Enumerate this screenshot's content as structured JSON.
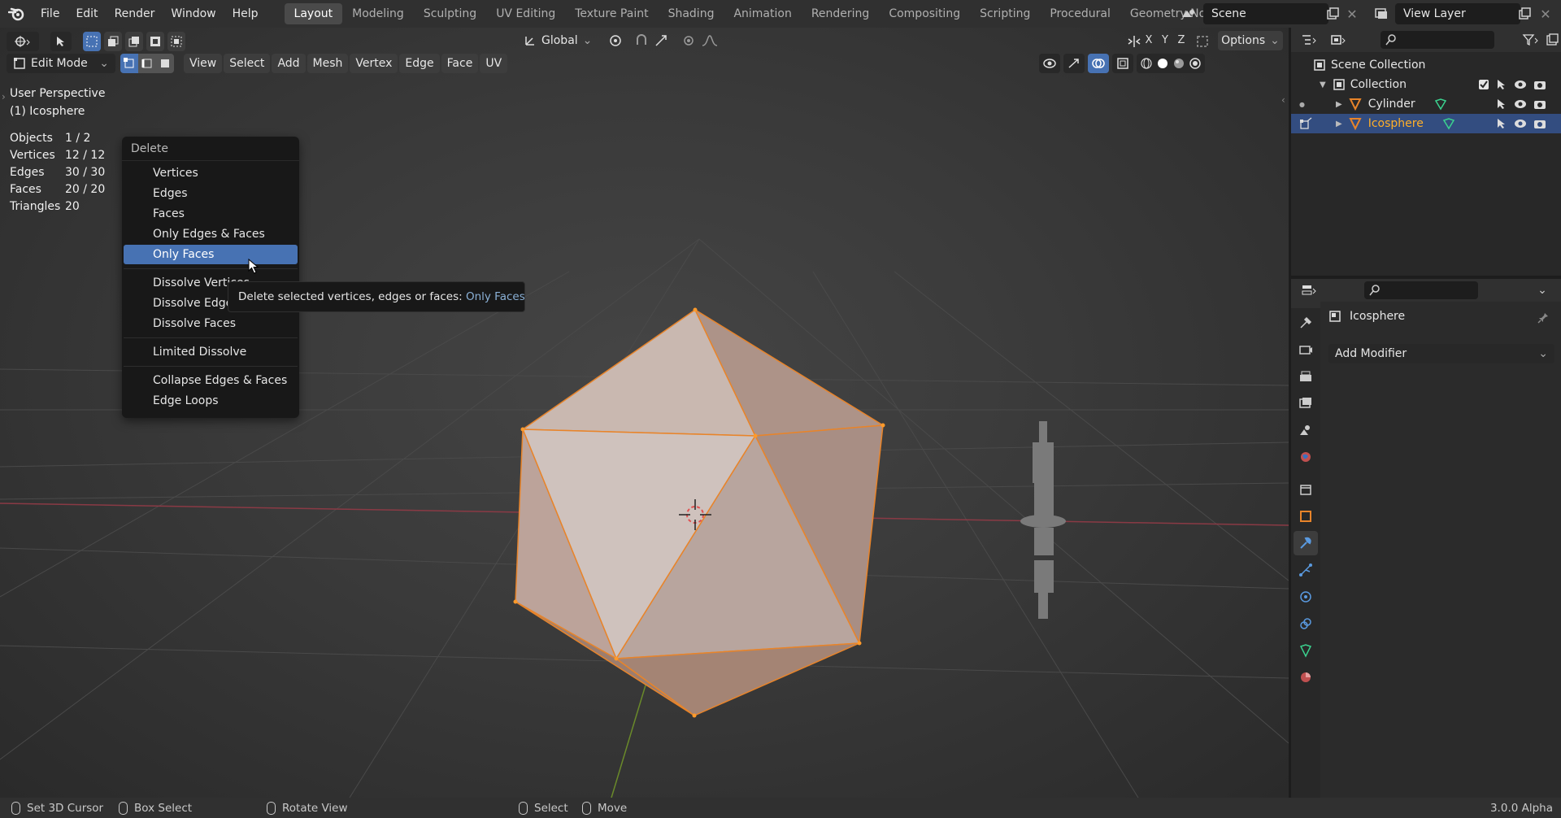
{
  "app": {
    "version": "3.0.0 Alpha"
  },
  "top_menu": [
    "File",
    "Edit",
    "Render",
    "Window",
    "Help"
  ],
  "workspaces": [
    {
      "label": "Layout",
      "active": true
    },
    {
      "label": "Modeling"
    },
    {
      "label": "Sculpting"
    },
    {
      "label": "UV Editing"
    },
    {
      "label": "Texture Paint"
    },
    {
      "label": "Shading"
    },
    {
      "label": "Animation"
    },
    {
      "label": "Rendering"
    },
    {
      "label": "Compositing"
    },
    {
      "label": "Scripting"
    },
    {
      "label": "Procedural"
    },
    {
      "label": "Geometry Nodes"
    }
  ],
  "scene": {
    "name": "Scene"
  },
  "view_layer": {
    "name": "View Layer"
  },
  "viewport": {
    "orientation": "Global",
    "options_label": "Options",
    "axes": [
      "X",
      "Y",
      "Z"
    ],
    "mode": "Edit Mode",
    "menus": [
      "View",
      "Select",
      "Add",
      "Mesh",
      "Vertex",
      "Edge",
      "Face",
      "UV"
    ],
    "perspective": "User Perspective",
    "active_object": "(1) Icosphere",
    "stats": [
      {
        "label": "Objects",
        "value": "1 / 2"
      },
      {
        "label": "Vertices",
        "value": "12 / 12"
      },
      {
        "label": "Edges",
        "value": "30 / 30"
      },
      {
        "label": "Faces",
        "value": "20 / 20"
      },
      {
        "label": "Triangles",
        "value": "20"
      }
    ]
  },
  "delete_menu": {
    "title": "Delete",
    "groups": [
      [
        "Vertices",
        "Edges",
        "Faces",
        "Only Edges & Faces",
        "Only Faces"
      ],
      [
        "Dissolve Vertices",
        "Dissolve Edges",
        "Dissolve Faces"
      ],
      [
        "Limited Dissolve"
      ],
      [
        "Collapse Edges & Faces",
        "Edge Loops"
      ]
    ],
    "highlighted": "Only Faces"
  },
  "tooltip": {
    "text": "Delete selected vertices, edges or faces:",
    "value": "Only Faces"
  },
  "outliner": {
    "root": "Scene Collection",
    "collection": "Collection",
    "objects": [
      {
        "name": "Cylinder",
        "selected": false
      },
      {
        "name": "Icosphere",
        "selected": true
      }
    ]
  },
  "properties": {
    "object_name": "Icosphere",
    "add_modifier_label": "Add Modifier"
  },
  "statusbar": [
    {
      "label": "Set 3D Cursor"
    },
    {
      "label": "Box Select"
    },
    {
      "label": "Rotate View"
    },
    {
      "label": "Select"
    },
    {
      "label": "Move"
    }
  ],
  "colors": {
    "accent": "#4772b3",
    "selection_orange": "#ffaf29",
    "header": "#303030",
    "viewport_bg": "#3d3d3d"
  }
}
